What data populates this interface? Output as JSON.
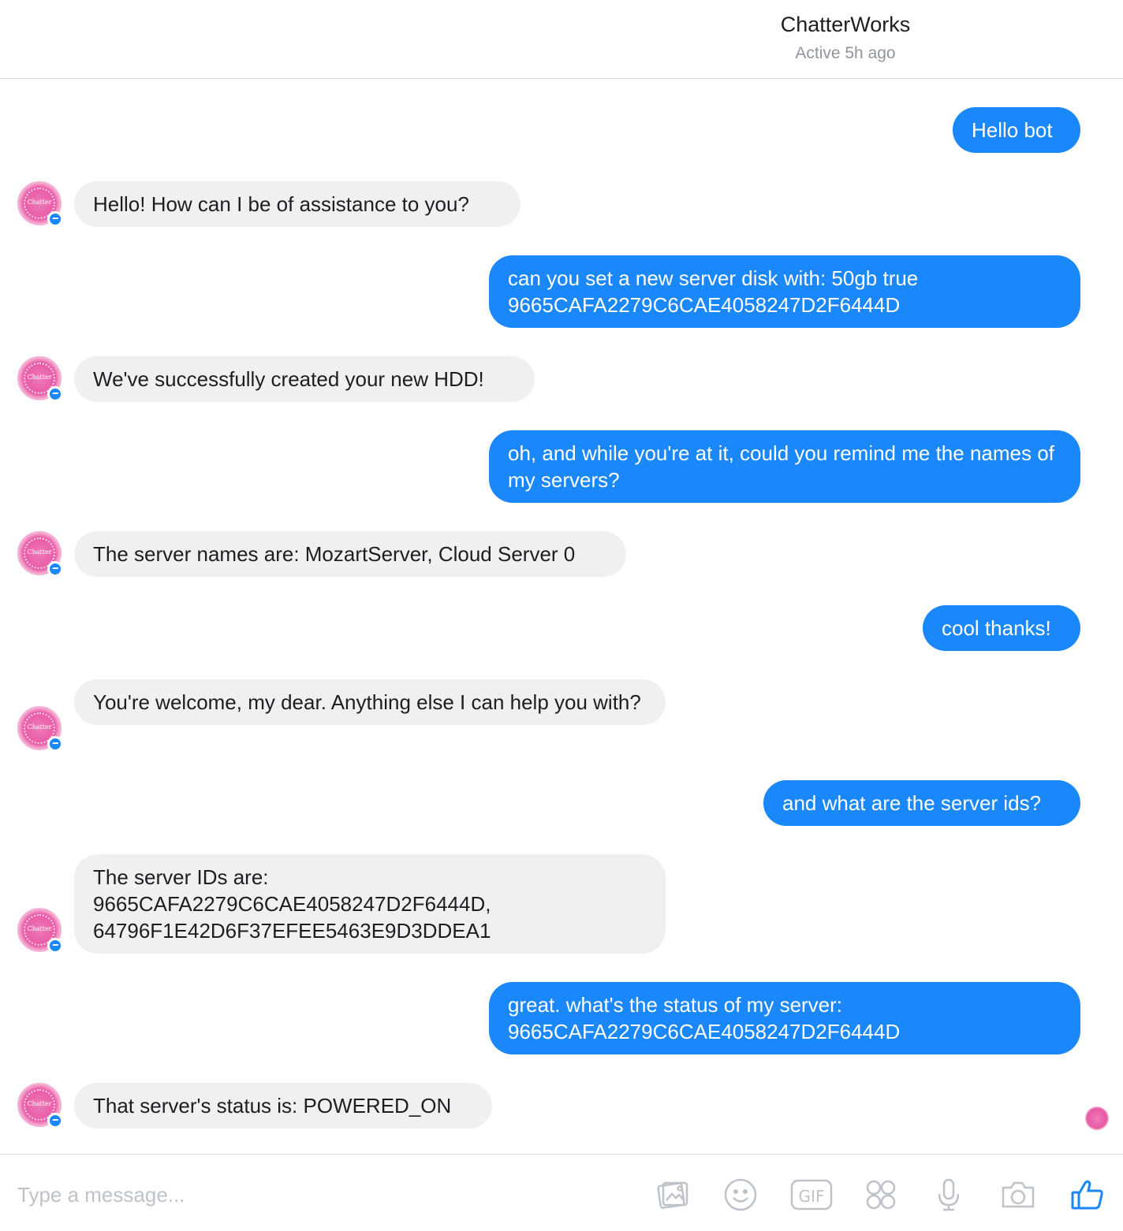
{
  "header": {
    "title": "ChatterWorks",
    "status": "Active 5h ago"
  },
  "messages": [
    {
      "from": "user",
      "text": "Hello bot"
    },
    {
      "from": "bot",
      "text": "Hello! How can I be of assistance to you?"
    },
    {
      "from": "user",
      "text": "can you set a new server disk with: 50gb true 9665CAFA2279C6CAE4058247D2F6444D"
    },
    {
      "from": "bot",
      "text": "We've successfully created your new HDD!"
    },
    {
      "from": "user",
      "text": "oh, and while you're at it, could you remind me the names of my servers?"
    },
    {
      "from": "bot",
      "text": "The server names are: MozartServer, Cloud Server 0"
    },
    {
      "from": "user",
      "text": "cool thanks!"
    },
    {
      "from": "bot",
      "text": "You're welcome, my dear. Anything else I can help you with?"
    },
    {
      "from": "user",
      "text": "and what are the server ids?"
    },
    {
      "from": "bot",
      "text": "The server IDs are: 9665CAFA2279C6CAE4058247D2F6444D, 64796F1E42D6F37EFEE5463E9D3DDEA1"
    },
    {
      "from": "user",
      "text": "great. what's the status of my server: 9665CAFA2279C6CAE4058247D2F6444D"
    },
    {
      "from": "bot",
      "text": "That server's status is: POWERED_ON"
    }
  ],
  "composer": {
    "placeholder": "Type a message...",
    "tools": [
      "image-icon",
      "emoji-icon",
      "gif-icon",
      "stickers-icon",
      "microphone-icon",
      "camera-icon",
      "thumbs-up-icon"
    ]
  },
  "colors": {
    "outgoing_bubble": "#1a87fa",
    "incoming_bubble": "#f1f0f0",
    "avatar_pink": "#e85aa6"
  }
}
